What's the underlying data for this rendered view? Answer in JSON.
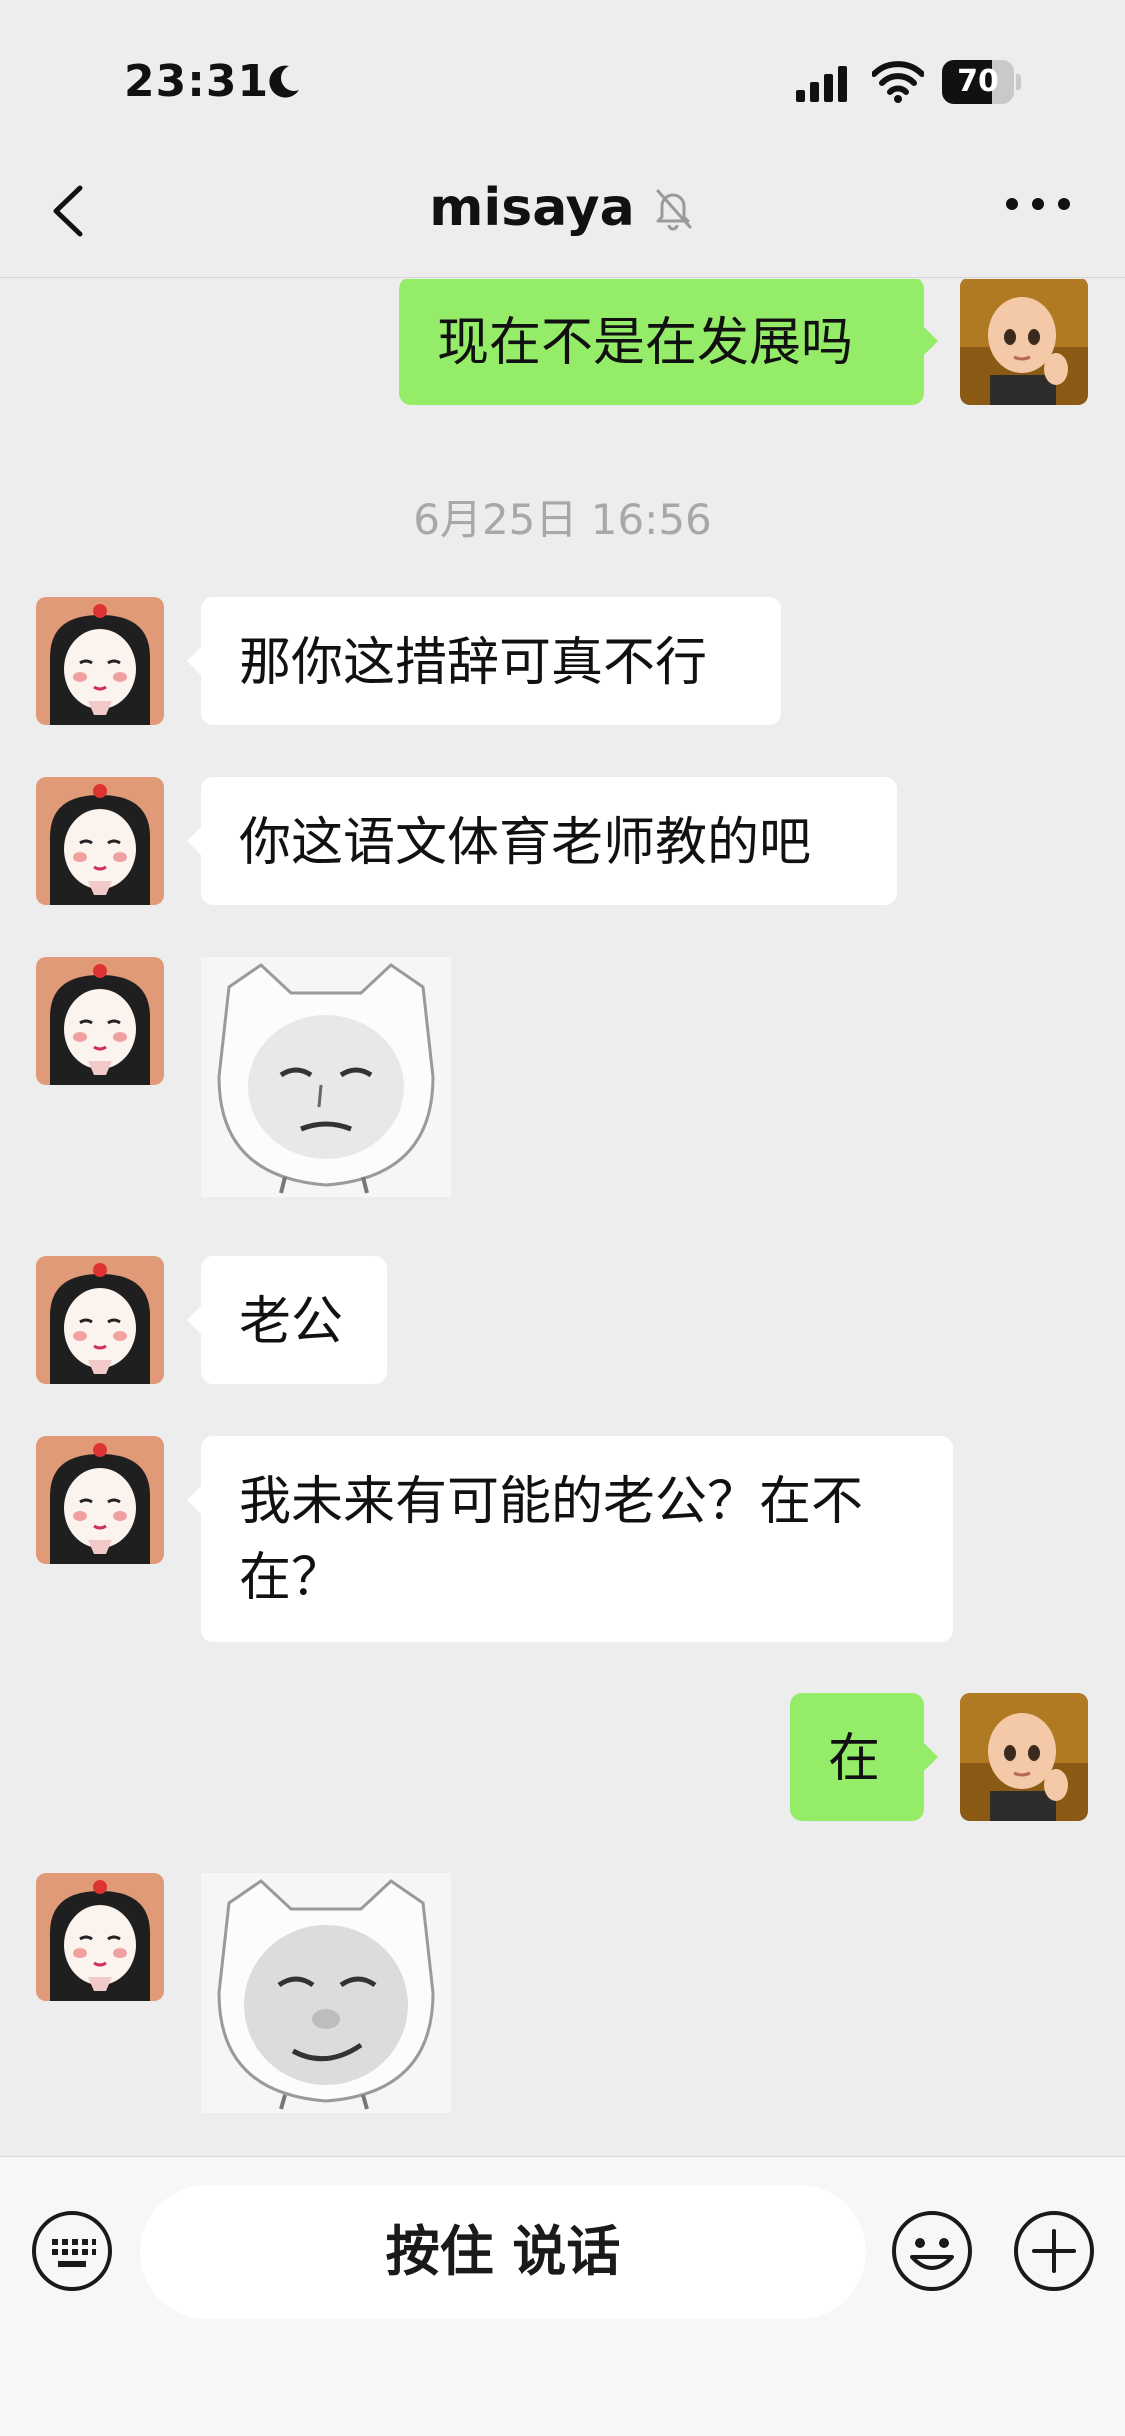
{
  "status_bar": {
    "time": "23:31",
    "battery_percent": "70",
    "battery_level": 0.7,
    "icons": [
      "moon-icon",
      "cellular-signal-icon",
      "wifi-icon",
      "battery-icon"
    ]
  },
  "header": {
    "title": "misaya",
    "icons": [
      "back-chevron-icon",
      "mute-bell-icon",
      "more-dots-icon"
    ]
  },
  "chat": {
    "messages": [
      {
        "side": "out",
        "type": "text",
        "text": "现在不是在发展吗"
      },
      {
        "type": "timestamp",
        "text": "6月25日 16:56"
      },
      {
        "side": "in",
        "type": "text",
        "text": "那你这措辞可真不行"
      },
      {
        "side": "in",
        "type": "text",
        "text": "你这语文体育老师教的吧"
      },
      {
        "side": "in",
        "type": "sticker",
        "sticker": "cat-face-sticker"
      },
      {
        "side": "in",
        "type": "text",
        "text": "老公"
      },
      {
        "side": "in",
        "type": "text",
        "text": "我未来有可能的老公？在不在？"
      },
      {
        "side": "out",
        "type": "text",
        "text": "在"
      },
      {
        "side": "in",
        "type": "sticker",
        "sticker": "smirk-face-sticker"
      }
    ]
  },
  "input_bar": {
    "voice_label": "按住 说话",
    "icons": [
      "keyboard-icon",
      "emoji-icon",
      "plus-icon"
    ]
  },
  "colors": {
    "background": "#ededed",
    "outgoing_bubble": "#95ec69",
    "incoming_bubble": "#ffffff",
    "timestamp_text": "#a8a8a8"
  }
}
